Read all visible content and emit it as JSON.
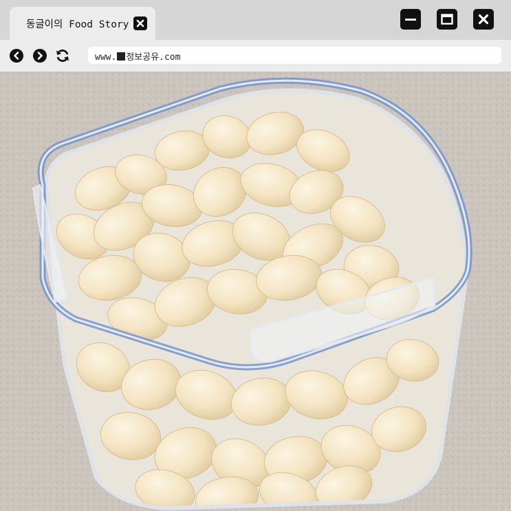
{
  "tab": {
    "title": "동글이의 Food Story"
  },
  "toolbar": {
    "url_prefix": "www.",
    "url_rest": "정보공유.com"
  },
  "content": {
    "image_subject": "peeled garlic cloves in a clear plastic container"
  },
  "colors": {
    "titlebar": "#d6d6d6",
    "tab": "#ececec",
    "button": "#111111",
    "counter": "#c9c3bc",
    "lid_seal": "#6f8fc8",
    "garlic": "#f3e3be"
  }
}
